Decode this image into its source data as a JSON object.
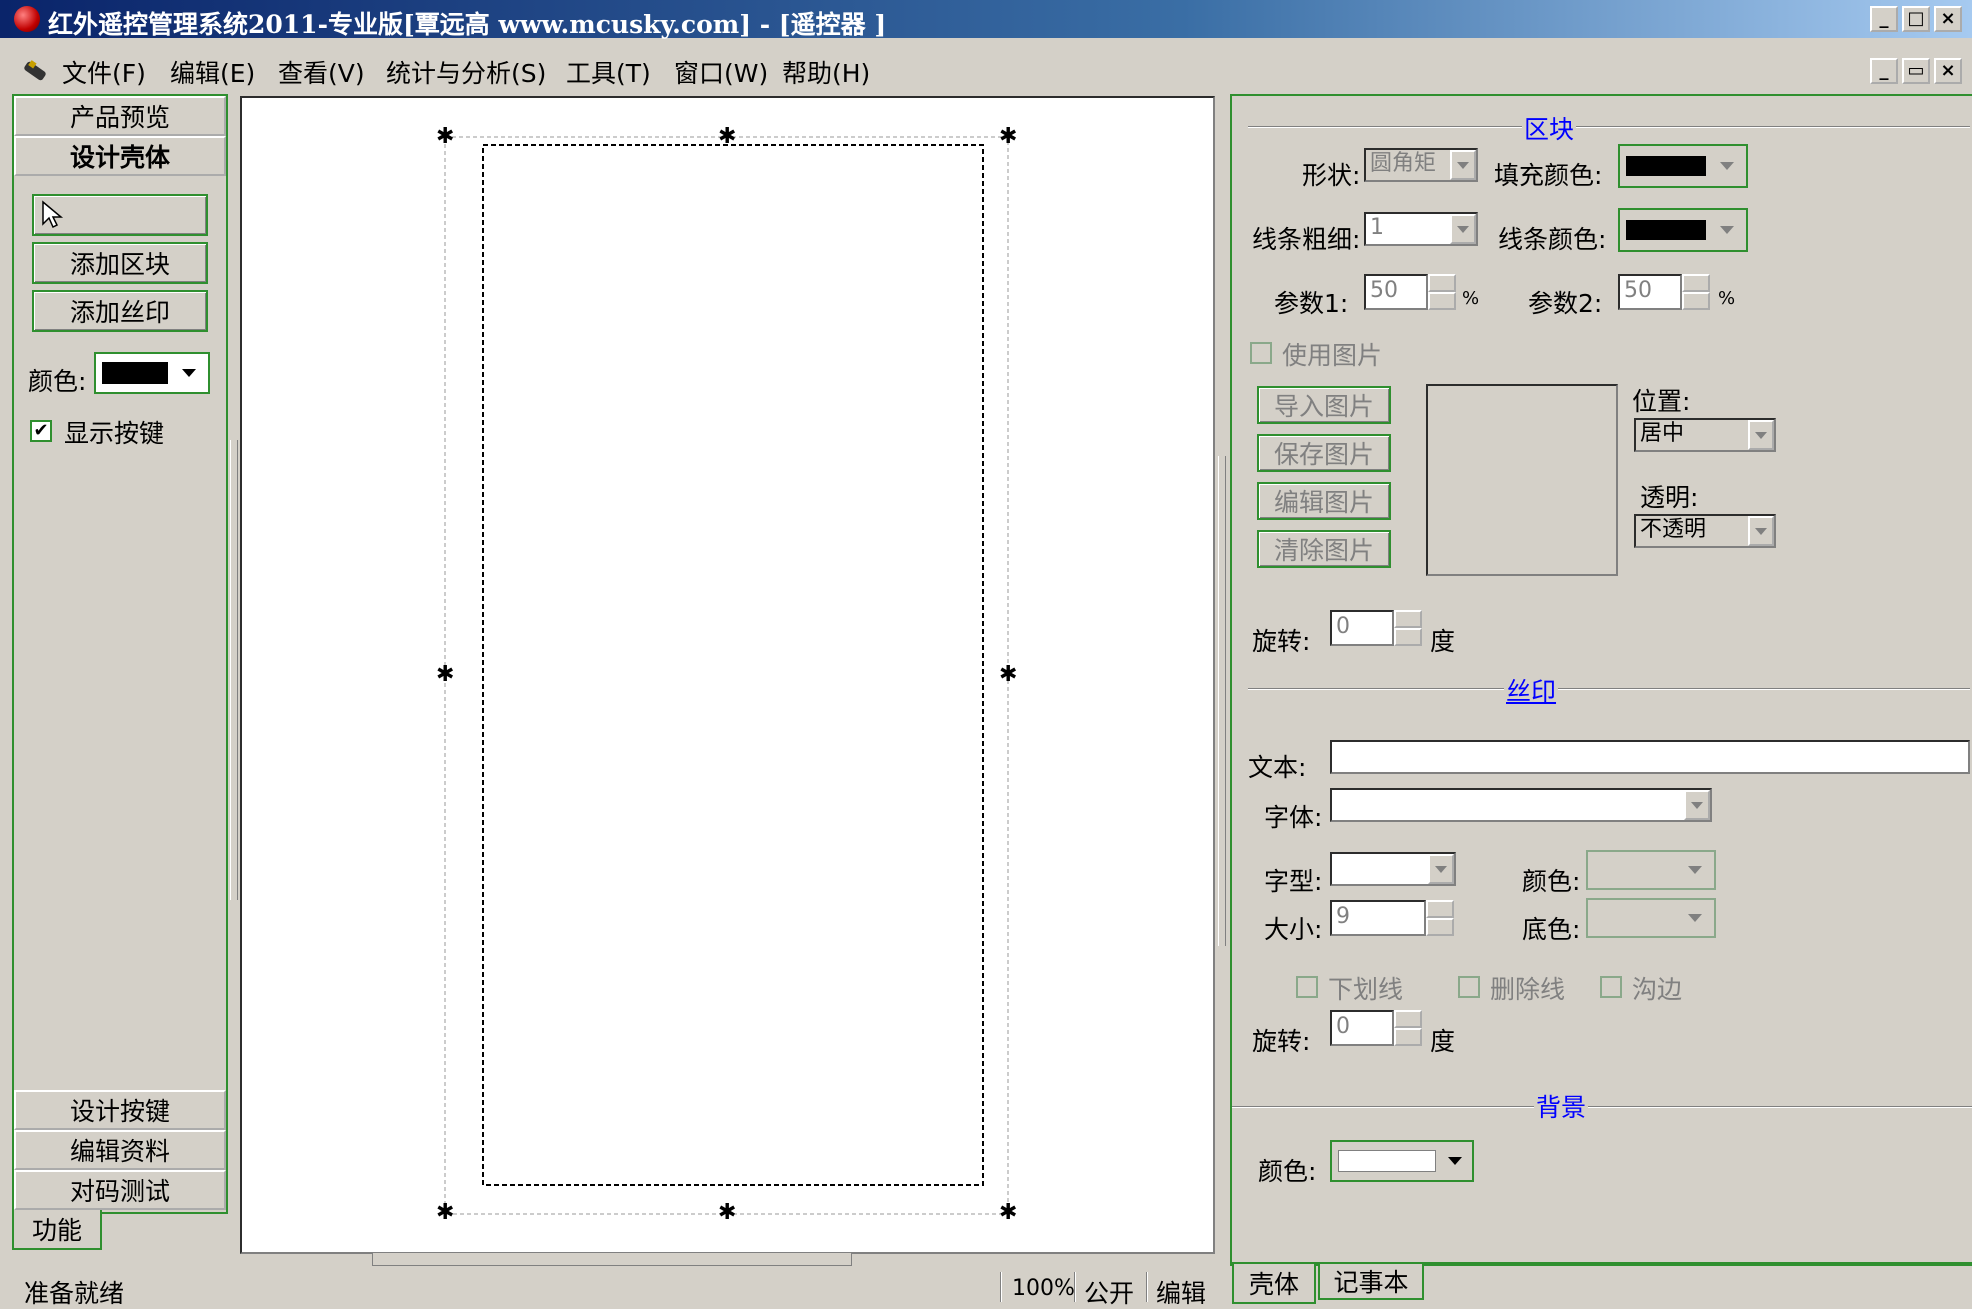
{
  "window": {
    "title": "红外遥控管理系统2011-专业版[覃远高 www.mcusky.com] - [遥控器 ]",
    "min_label": "_",
    "max_label": "□",
    "close_label": "×",
    "restore_label": "▭"
  },
  "menu": {
    "items": [
      "文件(F)",
      "编辑(E)",
      "查看(V)",
      "统计与分析(S)",
      "工具(T)",
      "窗口(W)",
      "帮助(H)"
    ]
  },
  "left_panel": {
    "header_preview": "产品预览",
    "header_design": "设计壳体",
    "pointer_icon": "arrow-pointer-icon",
    "add_block": "添加区块",
    "add_silkscreen": "添加丝印",
    "color_label": "颜色:",
    "color_value": "#000000",
    "show_keys_label": "显示按键",
    "show_keys_checked": "✔",
    "bottom_items": [
      "设计按键",
      "编辑资料",
      "对码测试"
    ],
    "function_tab": "功能"
  },
  "right_panel": {
    "block_section": "区块",
    "shape_label": "形状:",
    "shape_value": "圆角矩",
    "fill_color_label": "填充颜色:",
    "fill_color": "#000000",
    "line_width_label": "线条粗细:",
    "line_width_value": "1",
    "line_color_label": "线条颜色:",
    "line_color": "#000000",
    "param1_label": "参数1:",
    "param1_value": "50",
    "param1_unit": "%",
    "param2_label": "参数2:",
    "param2_value": "50",
    "param2_unit": "%",
    "use_image_label": "使用图片",
    "import_image": "导入图片",
    "save_image": "保存图片",
    "edit_image": "编辑图片",
    "clear_image": "清除图片",
    "position_label": "位置:",
    "position_value": "居中",
    "transparent_label": "透明:",
    "transparent_value": "不透明",
    "rotate_label": "旋转:",
    "rotate_value": "0",
    "rotate_unit": "度",
    "silk_section": "丝印",
    "text_label": "文本:",
    "font_label": "字体:",
    "style_label": "字型:",
    "silk_color_label": "颜色:",
    "size_label": "大小:",
    "size_value": "9",
    "bg_color_label": "底色:",
    "underline_label": "下划线",
    "strike_label": "删除线",
    "outline_label": "沟边",
    "silk_rotate_label": "旋转:",
    "silk_rotate_value": "0",
    "silk_rotate_unit": "度",
    "background_section": "背景",
    "background_color_label": "颜色:",
    "background_color": "#ffffff",
    "tab_shell": "壳体",
    "tab_notepad": "记事本"
  },
  "status_bar": {
    "ready": "准备就绪",
    "zoom": "100%",
    "visibility": "公开",
    "mode": "编辑"
  }
}
